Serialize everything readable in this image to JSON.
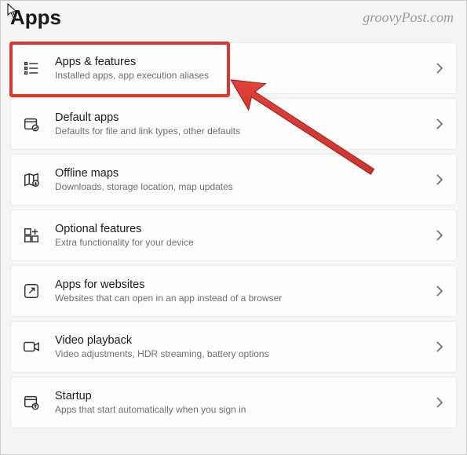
{
  "page": {
    "title": "Apps"
  },
  "watermark": "groovyPost.com",
  "items": [
    {
      "icon": "apps-features-icon",
      "title": "Apps & features",
      "sub": "Installed apps, app execution aliases"
    },
    {
      "icon": "default-apps-icon",
      "title": "Default apps",
      "sub": "Defaults for file and link types, other defaults"
    },
    {
      "icon": "offline-maps-icon",
      "title": "Offline maps",
      "sub": "Downloads, storage location, map updates"
    },
    {
      "icon": "optional-features-icon",
      "title": "Optional features",
      "sub": "Extra functionality for your device"
    },
    {
      "icon": "apps-websites-icon",
      "title": "Apps for websites",
      "sub": "Websites that can open in an app instead of a browser"
    },
    {
      "icon": "video-playback-icon",
      "title": "Video playback",
      "sub": "Video adjustments, HDR streaming, battery options"
    },
    {
      "icon": "startup-icon",
      "title": "Startup",
      "sub": "Apps that start automatically when you sign in"
    }
  ],
  "annotation": {
    "highlight_index": 0,
    "color": "#d9382f"
  }
}
